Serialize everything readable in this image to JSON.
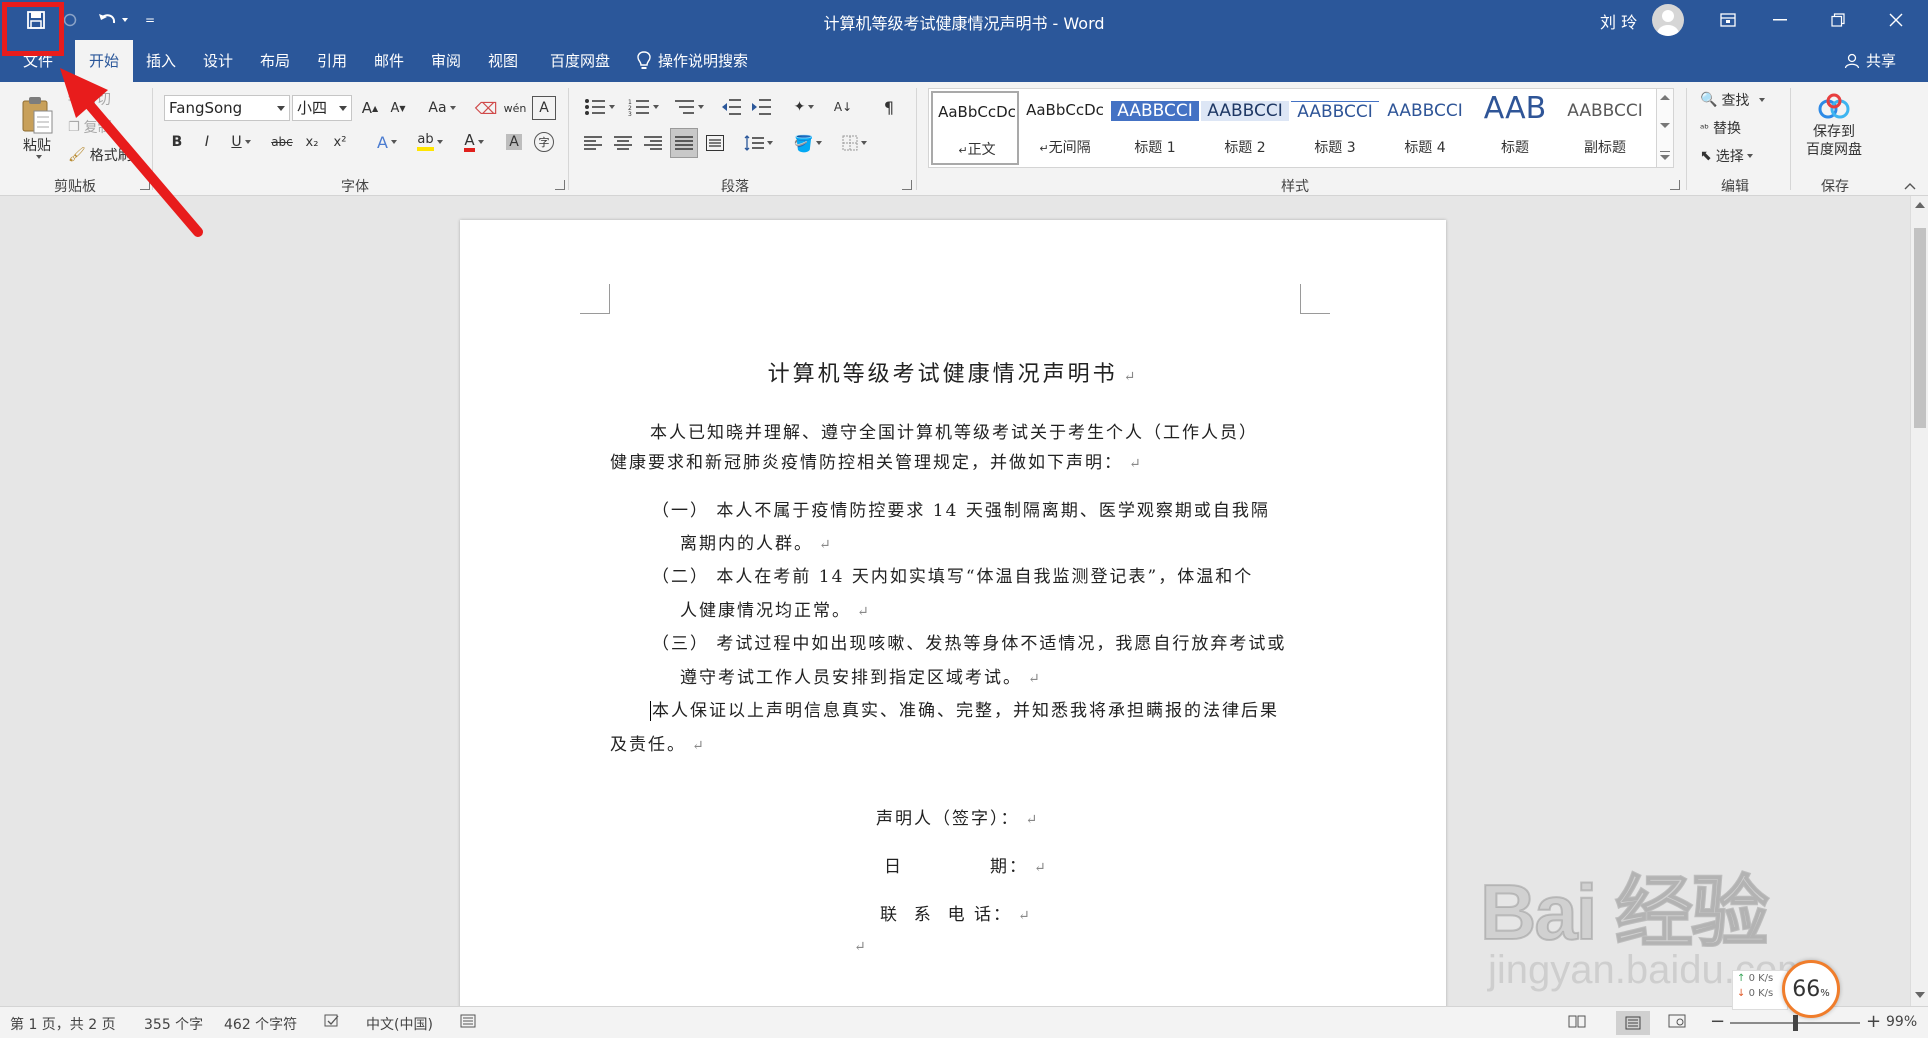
{
  "window": {
    "title": "计算机等级考试健康情况声明书 - Word",
    "user_name": "刘 玲",
    "more_glyph": "="
  },
  "tabs": [
    {
      "label": "文件"
    },
    {
      "label": "开始"
    },
    {
      "label": "插入"
    },
    {
      "label": "设计"
    },
    {
      "label": "布局"
    },
    {
      "label": "引用"
    },
    {
      "label": "邮件"
    },
    {
      "label": "审阅"
    },
    {
      "label": "视图"
    },
    {
      "label": "百度网盘"
    }
  ],
  "tell_me": "操作说明搜索",
  "share": "共享",
  "ribbon": {
    "clipboard": {
      "paste": "粘贴",
      "cut": "剪切",
      "copy": "复制",
      "format_painter": "格式刷",
      "label": "剪贴板"
    },
    "font": {
      "name": "FangSong",
      "size": "小四",
      "label": "字体",
      "change_case": "Aa",
      "bold": "B",
      "italic": "I",
      "underline": "U",
      "strike": "abc",
      "subscript": "x₂",
      "superscript": "x²",
      "grow": "A",
      "shrink": "A",
      "clear": "A",
      "text_effect": "A",
      "font_color": "A",
      "char_shading": "A",
      "phonetic": "wén",
      "char_border": "A",
      "enclose": "字",
      "highlight": "ab"
    },
    "paragraph": {
      "label": "段落",
      "sort": "A↓",
      "marks": "¶"
    },
    "styles": {
      "label": "样式",
      "items": [
        {
          "preview": "AaBbCcDc",
          "name": "正文"
        },
        {
          "preview": "AaBbCcDc",
          "name": "无间隔"
        },
        {
          "preview": "AABBCCI",
          "name": "标题 1"
        },
        {
          "preview": "AABBCCI",
          "name": "标题 2"
        },
        {
          "preview": "AABBCCI",
          "name": "标题 3"
        },
        {
          "preview": "AABBCCI",
          "name": "标题 4"
        },
        {
          "preview": "AAB",
          "name": "标题"
        },
        {
          "preview": "AABBCCI",
          "name": "副标题"
        }
      ]
    },
    "editing": {
      "find": "查找",
      "replace": "替换",
      "select": "选择",
      "label": "编辑"
    },
    "save_group": {
      "button": "保存到\n百度网盘",
      "label": "保存"
    }
  },
  "document": {
    "title": "计算机等级考试健康情况声明书",
    "intro_line1": "本人已知晓并理解、遵守全国计算机等级考试关于考生个人（工作人员）",
    "intro_line2": "健康要求和新冠肺炎疫情防控相关管理规定，并做如下声明：",
    "item1_line1": "（一） 本人不属于疫情防控要求 14 天强制隔离期、医学观察期或自我隔",
    "item1_line2": "离期内的人群。",
    "item2_line1": "（二） 本人在考前 14 天内如实填写“体温自我监测登记表”，体温和个",
    "item2_line2": "人健康情况均正常。",
    "item3_line1": "（三） 考试过程中如出现咳嗽、发热等身体不适情况，我愿自行放弃考试或",
    "item3_line2": "遵守考试工作人员安排到指定区域考试。",
    "guarantee_line1": "本人保证以上声明信息真实、准确、完整，并知悉我将承担瞒报的法律后果",
    "guarantee_line2": "及责任。",
    "signature": "声明人（签字）：",
    "date_label_1": "日",
    "date_label_2": "期：",
    "phone_label": "联  系  电 话：",
    "para_mark": "↵"
  },
  "statusbar": {
    "page": "第 1 页，共 2 页",
    "word_count": "355 个字",
    "char_count": "462 个字符",
    "language": "中文(中国)",
    "zoom_minus": "−",
    "zoom_plus": "+",
    "zoom_level": "99%",
    "zoom_fraction": 0.5
  },
  "watermark": {
    "logo": "Bai 经验",
    "url": "jingyan.baidu.com"
  },
  "net_widget": {
    "up": "0  K/s",
    "down": "0  K/s",
    "value": "66",
    "unit": "%"
  },
  "colors": {
    "title_bar": "#2b579a",
    "annotation_red": "#e81c1c",
    "heading_style_fill": "#4472c4"
  }
}
